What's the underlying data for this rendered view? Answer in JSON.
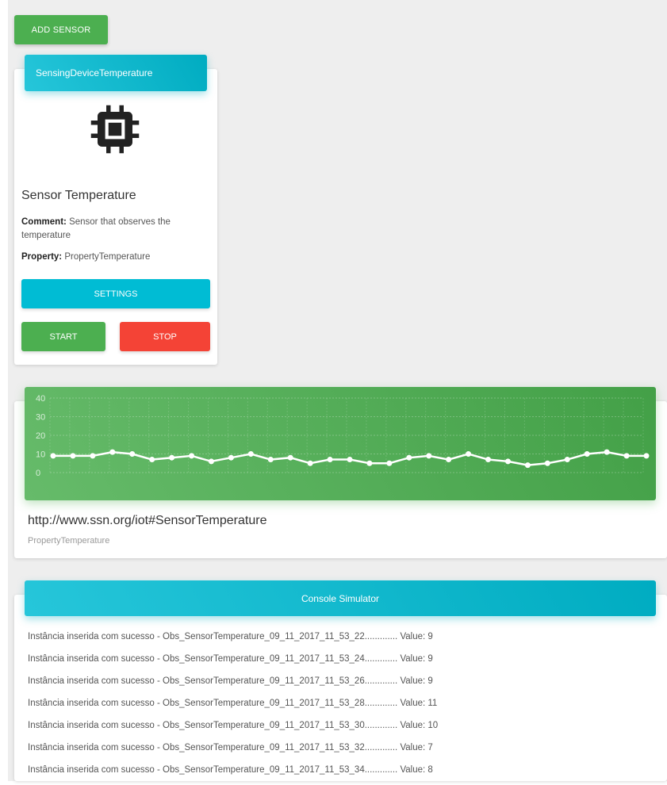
{
  "toolbar": {
    "add_sensor_label": "ADD SENSOR"
  },
  "sensor_card": {
    "header": "SensingDeviceTemperature",
    "icon": "chip-icon",
    "name": "Sensor Temperature",
    "comment_label": "Comment:",
    "comment_text": "Sensor that observes the temperature",
    "property_label": "Property:",
    "property_text": "PropertyTemperature",
    "settings_label": "SETTINGS",
    "start_label": "START",
    "stop_label": "STOP"
  },
  "chart_card": {
    "title": "http://www.ssn.org/iot#SensorTemperature",
    "subtitle": "PropertyTemperature"
  },
  "chart_data": {
    "type": "line",
    "y_ticks": [
      "40",
      "30",
      "20",
      "10",
      "0"
    ],
    "ylim": [
      0,
      40
    ],
    "grid": true,
    "values": [
      9,
      9,
      9,
      11,
      10,
      7,
      8,
      9,
      6,
      8,
      10,
      7,
      8,
      5,
      7,
      7,
      5,
      5,
      8,
      9,
      7,
      10,
      7,
      6,
      4,
      5,
      7,
      10,
      11,
      9,
      9
    ],
    "line_color": "#ffffff"
  },
  "console": {
    "header": "Console Simulator",
    "lines": [
      "Instância inserida com sucesso - Obs_SensorTemperature_09_11_2017_11_53_22............. Value: 9",
      "Instância inserida com sucesso - Obs_SensorTemperature_09_11_2017_11_53_24............. Value: 9",
      "Instância inserida com sucesso - Obs_SensorTemperature_09_11_2017_11_53_26............. Value: 9",
      "Instância inserida com sucesso - Obs_SensorTemperature_09_11_2017_11_53_28............. Value: 11",
      "Instância inserida com sucesso - Obs_SensorTemperature_09_11_2017_11_53_30............. Value: 10",
      "Instância inserida com sucesso - Obs_SensorTemperature_09_11_2017_11_53_32............. Value: 7",
      "Instância inserida com sucesso - Obs_SensorTemperature_09_11_2017_11_53_34............. Value: 8"
    ]
  },
  "colors": {
    "primary_green": "#4caf50",
    "primary_cyan": "#00bcd4",
    "danger_red": "#f44336",
    "background": "#eeeeee"
  }
}
